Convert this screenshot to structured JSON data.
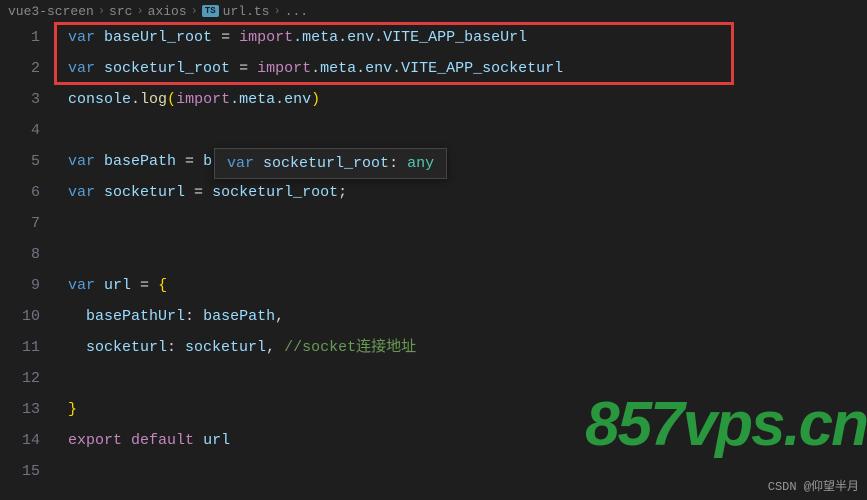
{
  "breadcrumb": {
    "parts": [
      "vue3-screen",
      "src",
      "axios"
    ],
    "fileBadge": "TS",
    "fileName": "url.ts",
    "trailing": "..."
  },
  "lineNumbers": [
    "1",
    "2",
    "3",
    "4",
    "5",
    "6",
    "7",
    "8",
    "9",
    "10",
    "11",
    "12",
    "13",
    "14",
    "15"
  ],
  "code": {
    "l1": {
      "var": "var",
      "name": "baseUrl_root",
      "eq": " = ",
      "imp": "import",
      "rest": ".meta.env.VITE_APP_baseUrl"
    },
    "l2": {
      "var": "var",
      "name": "socketurl_root",
      "eq": " = ",
      "imp": "import",
      "rest": ".meta.env.VITE_APP_socketurl"
    },
    "l3": {
      "obj": "console",
      "dot": ".",
      "fn": "log",
      "op": "(",
      "imp": "import",
      "rest": ".meta.env",
      "cp": ")"
    },
    "l5": {
      "var": "var",
      "name": "basePath",
      "eq": " = ",
      "rhs": "b"
    },
    "l6": {
      "var": "var",
      "name": "socketurl",
      "eq": " = ",
      "rhs": "socketurl_root",
      "semi": ";"
    },
    "l9": {
      "var": "var",
      "name": "url",
      "eq": " = ",
      "brace": "{"
    },
    "l10": {
      "key": "basePathUrl",
      "colon": ": ",
      "val": "basePath",
      "comma": ","
    },
    "l11": {
      "key": "socketurl",
      "colon": ": ",
      "val": "socketurl",
      "comma": ",",
      "sp": " ",
      "comment": "//socket连接地址"
    },
    "l13": {
      "brace": "}"
    },
    "l14": {
      "exp": "export",
      "def": "default",
      "name": "url"
    }
  },
  "tooltip": {
    "var": "var",
    "name": "socketurl_root",
    "colon": ": ",
    "type": "any"
  },
  "watermark": "857vps.cn",
  "csdn": "CSDN @仰望半月"
}
